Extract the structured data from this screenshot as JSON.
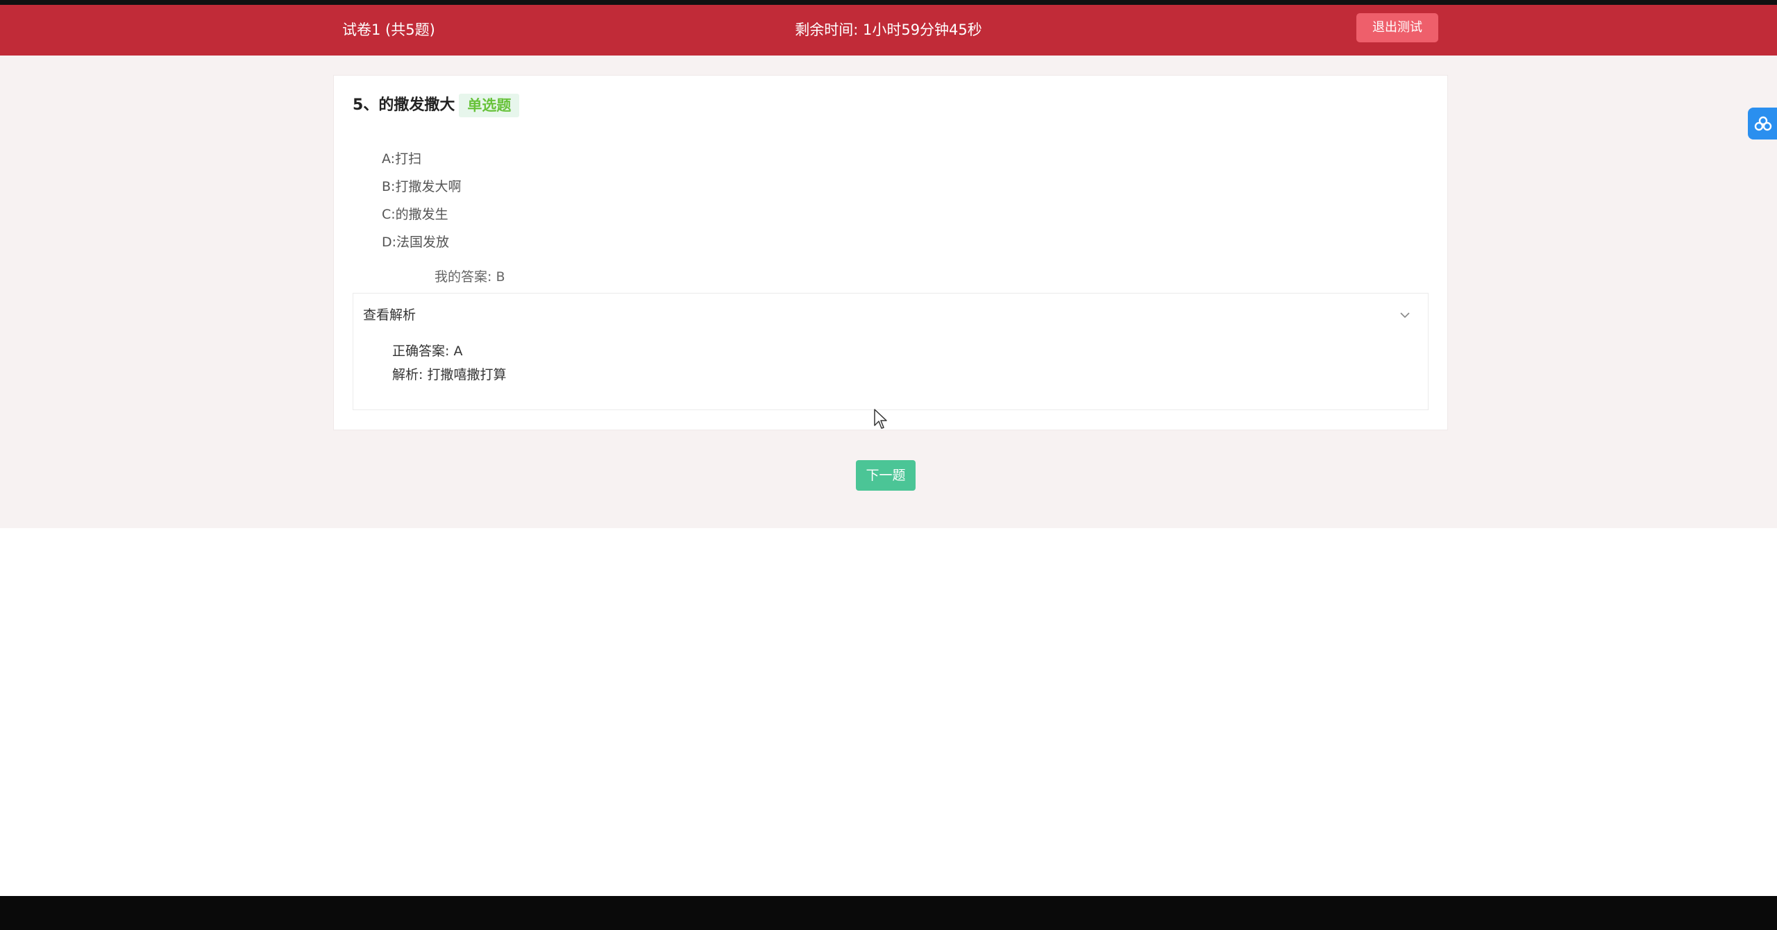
{
  "header": {
    "exam_title": "试卷1 (共5题)",
    "timer": "剩余时间: 1小时59分钟45秒",
    "exit_label": "退出测试"
  },
  "question": {
    "number": "5、",
    "text": "的撒发撒大",
    "type_tag": "单选题",
    "options": [
      {
        "key": "A:",
        "text": "打扫"
      },
      {
        "key": "B:",
        "text": "打撒发大啊"
      },
      {
        "key": "C:",
        "text": "的撒发生"
      },
      {
        "key": "D:",
        "text": "法国发放"
      }
    ],
    "my_answer": "我的答案: B"
  },
  "analysis": {
    "title": "查看解析",
    "correct_answer": "正确答案: A",
    "explanation": "解析: 打撒嘻撒打算"
  },
  "next_label": "下一题",
  "colors": {
    "header_bg": "#c12b38",
    "exit_button": "#ee5f6b",
    "next_button": "#4bc596",
    "tag_text": "#67c23a",
    "tag_bg": "#e7f6ec",
    "page_bg": "#f7f2f2",
    "side_widget": "#2a8fef"
  },
  "icons": {
    "collapse": "chevron-down-icon",
    "side_widget": "link-icon",
    "cursor": "mouse-pointer-icon"
  }
}
